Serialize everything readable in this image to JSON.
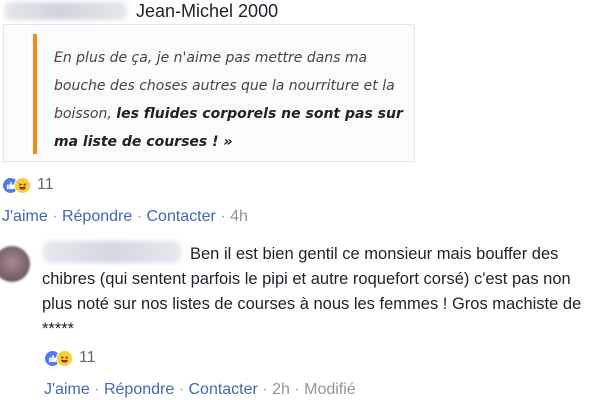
{
  "comment1": {
    "author": "Jean-Michel 2000",
    "quote": {
      "text_plain": "En plus de ça, je n'aime pas mettre dans ma bouche des choses autres que la nourriture et la boisson,",
      "text_bold": "les fluides corporels ne sont pas sur ma liste de courses ! »"
    },
    "reactions": {
      "icons": [
        "like-icon",
        "haha-icon"
      ],
      "count": "11"
    },
    "actions": {
      "like": "J'aime",
      "reply": "Répondre",
      "contact": "Contacter",
      "separator": "·",
      "time": "4h"
    }
  },
  "comment2": {
    "text": "Ben il est bien gentil ce monsieur mais bouffer des chibres (qui sentent parfois le pipi et autre roquefort corsé) c'est pas non plus noté sur nos listes de courses à nous les femmes ! Gros machiste de *****",
    "reactions": {
      "icons": [
        "like-icon",
        "haha-icon"
      ],
      "count": "11"
    },
    "actions": {
      "like": "J'aime",
      "reply": "Répondre",
      "contact": "Contacter",
      "separator": "·",
      "time": "2h",
      "edited": "Modifié"
    }
  },
  "colors": {
    "link": "#4267b2",
    "meta": "#90949c",
    "quote_bar": "#f28a1a",
    "like": "#4b7bec",
    "haha": "#f7cd3c"
  }
}
